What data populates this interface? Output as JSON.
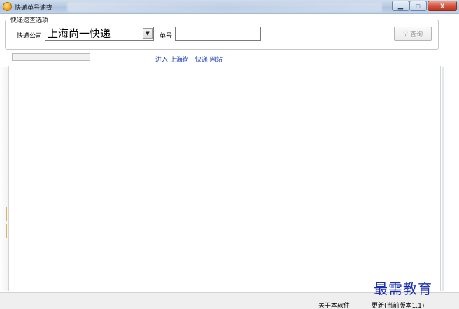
{
  "window": {
    "title": "快递单号速查",
    "controls": {
      "minimize": "▁",
      "maximize": "□",
      "close": "X"
    }
  },
  "search": {
    "group_label": "快递速查选项",
    "company_label": "快递公司",
    "company_value": "上海尚一快递",
    "number_label": "单号",
    "number_value": "",
    "query_button": "查询",
    "query_icon": "key-icon"
  },
  "progress": {
    "value": 0
  },
  "link": {
    "text": "进入 上海尚一快递 网站"
  },
  "statusbar": {
    "about": "关于本软件",
    "update": "更新(当前版本1.1)"
  },
  "watermark": {
    "text": "最需教育"
  },
  "colors": {
    "titlebar": "#b9cce3",
    "link": "#1c3fbf",
    "close_button": "#c0351f",
    "watermark": "#1a2fb0"
  }
}
